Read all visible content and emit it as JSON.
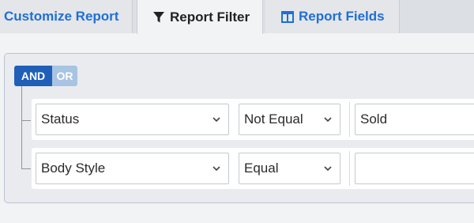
{
  "tabs": [
    {
      "label": "Customize Report",
      "icon": "none",
      "active": false
    },
    {
      "label": "Report Filter",
      "icon": "filter-icon",
      "active": true
    },
    {
      "label": "Report Fields",
      "icon": "columns-icon",
      "active": false
    }
  ],
  "logic_toggle": {
    "and_label": "AND",
    "or_label": "OR",
    "selected": "AND"
  },
  "filters": [
    {
      "field": "Status",
      "operator": "Not Equal",
      "value": "Sold"
    },
    {
      "field": "Body Style",
      "operator": "Equal",
      "value": ""
    }
  ],
  "colors": {
    "link_blue": "#1f6fd6",
    "and_active": "#1f5fb8",
    "or_inactive": "#a9c3e3",
    "panel_bg": "#e9ebee"
  }
}
